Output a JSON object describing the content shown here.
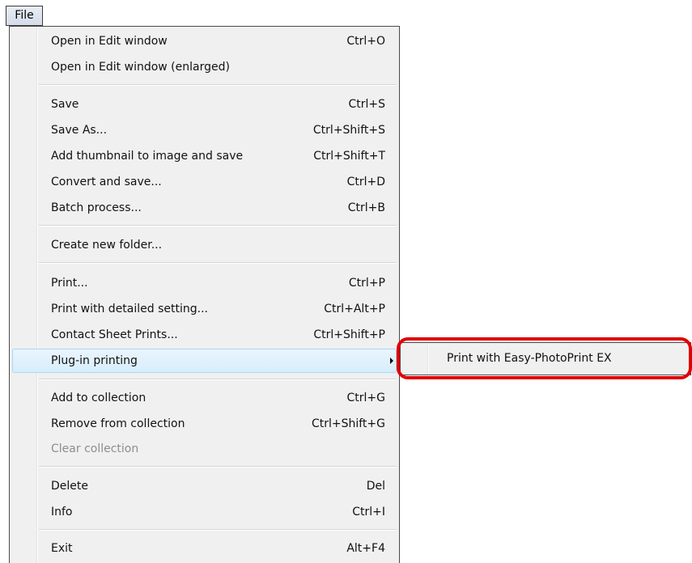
{
  "menubar": {
    "file_label": "File"
  },
  "menu": {
    "items": [
      {
        "label": "Open in Edit window",
        "shortcut": "Ctrl+O"
      },
      {
        "label": "Open in Edit window (enlarged)",
        "shortcut": ""
      },
      {
        "label": "Save",
        "shortcut": "Ctrl+S"
      },
      {
        "label": "Save As...",
        "shortcut": "Ctrl+Shift+S"
      },
      {
        "label": "Add thumbnail to image and save",
        "shortcut": "Ctrl+Shift+T"
      },
      {
        "label": "Convert and save...",
        "shortcut": "Ctrl+D"
      },
      {
        "label": "Batch process...",
        "shortcut": "Ctrl+B"
      },
      {
        "label": "Create new folder...",
        "shortcut": ""
      },
      {
        "label": "Print...",
        "shortcut": "Ctrl+P"
      },
      {
        "label": "Print with detailed setting...",
        "shortcut": "Ctrl+Alt+P"
      },
      {
        "label": "Contact Sheet Prints...",
        "shortcut": "Ctrl+Shift+P"
      },
      {
        "label": "Plug-in printing",
        "shortcut": "",
        "state": "highlighted",
        "has_submenu": true
      },
      {
        "label": "Add to collection",
        "shortcut": "Ctrl+G"
      },
      {
        "label": "Remove from collection",
        "shortcut": "Ctrl+Shift+G"
      },
      {
        "label": "Clear collection",
        "shortcut": "",
        "state": "disabled"
      },
      {
        "label": "Delete",
        "shortcut": "Del"
      },
      {
        "label": "Info",
        "shortcut": "Ctrl+I"
      },
      {
        "label": "Exit",
        "shortcut": "Alt+F4"
      }
    ]
  },
  "submenu": {
    "items": [
      {
        "label": "Print with Easy-PhotoPrint EX"
      }
    ]
  },
  "colors": {
    "highlight_border": "#a8d8f8",
    "callout": "#e00000",
    "disabled_text": "#8d8d8d",
    "menu_background": "#f0f0f0"
  }
}
